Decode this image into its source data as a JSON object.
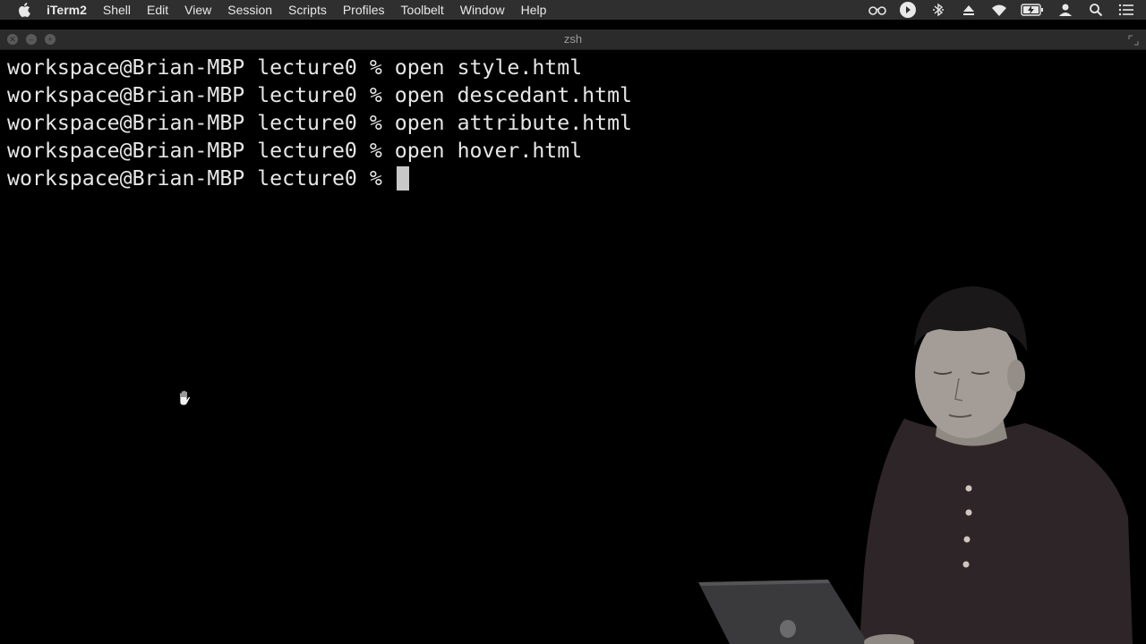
{
  "menubar": {
    "app_name": "iTerm2",
    "items": [
      "Shell",
      "Edit",
      "View",
      "Session",
      "Scripts",
      "Profiles",
      "Toolbelt",
      "Window",
      "Help"
    ],
    "status_icons": [
      "glasses-icon",
      "play-icon",
      "bluetooth-icon",
      "eject-icon",
      "wifi-icon",
      "battery-icon",
      "user-icon",
      "search-icon",
      "list-icon"
    ]
  },
  "window": {
    "title": "zsh"
  },
  "terminal": {
    "prompt": "workspace@Brian-MBP lecture0 % ",
    "lines": [
      {
        "prompt": "workspace@Brian-MBP lecture0 % ",
        "command": "open style.html"
      },
      {
        "prompt": "workspace@Brian-MBP lecture0 % ",
        "command": "open descedant.html"
      },
      {
        "prompt": "workspace@Brian-MBP lecture0 % ",
        "command": "open attribute.html"
      },
      {
        "prompt": "workspace@Brian-MBP lecture0 % ",
        "command": "open hover.html"
      }
    ],
    "current_prompt": "workspace@Brian-MBP lecture0 % "
  },
  "colors": {
    "menubar_bg": "#2f2f2f",
    "terminal_bg": "#000000",
    "terminal_fg": "#e6e6e6"
  }
}
